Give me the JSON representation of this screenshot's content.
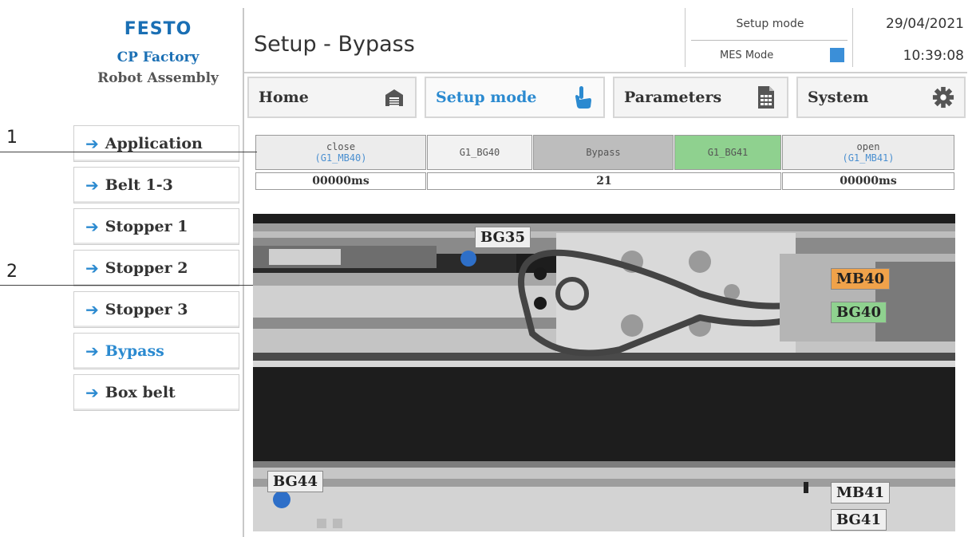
{
  "logo": {
    "brand": "FESTO",
    "line1": "CP Factory",
    "line2": "Robot Assembly"
  },
  "header": {
    "title": "Setup - Bypass",
    "mode_top": "Setup mode",
    "mode_bottom": "MES Mode",
    "date": "29/04/2021",
    "time": "10:39:08"
  },
  "nav": [
    {
      "label": "Home",
      "icon": "garage-icon"
    },
    {
      "label": "Setup mode",
      "icon": "hand-pointer-icon"
    },
    {
      "label": "Parameters",
      "icon": "document-icon"
    },
    {
      "label": "System",
      "icon": "gear-icon"
    }
  ],
  "sidebar": [
    {
      "label": "Application"
    },
    {
      "label": "Belt 1-3"
    },
    {
      "label": "Stopper 1"
    },
    {
      "label": "Stopper 2"
    },
    {
      "label": "Stopper 3"
    },
    {
      "label": "Bypass"
    },
    {
      "label": "Box belt"
    }
  ],
  "status": {
    "close_label": "close",
    "close_sub": "(G1_MB40)",
    "sensor1": "G1_BG40",
    "bypass": "Bypass",
    "sensor2": "G1_BG41",
    "open_label": "open",
    "open_sub": "(G1_MB41)",
    "close_time": "00000ms",
    "counter": "21",
    "open_time": "00000ms"
  },
  "callouts": {
    "one": "1",
    "two": "2"
  },
  "image_tags": {
    "bg35": "BG35",
    "mb40": "MB40",
    "bg40": "BG40",
    "bg44": "BG44",
    "mb41": "MB41",
    "bg41": "BG41"
  },
  "colors": {
    "accent_blue": "#2b8ad0",
    "mb40_orange": "#f0a24a",
    "bg40_green": "#8fd18f",
    "bg41_green_cell": "#8fd18f",
    "bypass_grey": "#bdbdbd"
  }
}
